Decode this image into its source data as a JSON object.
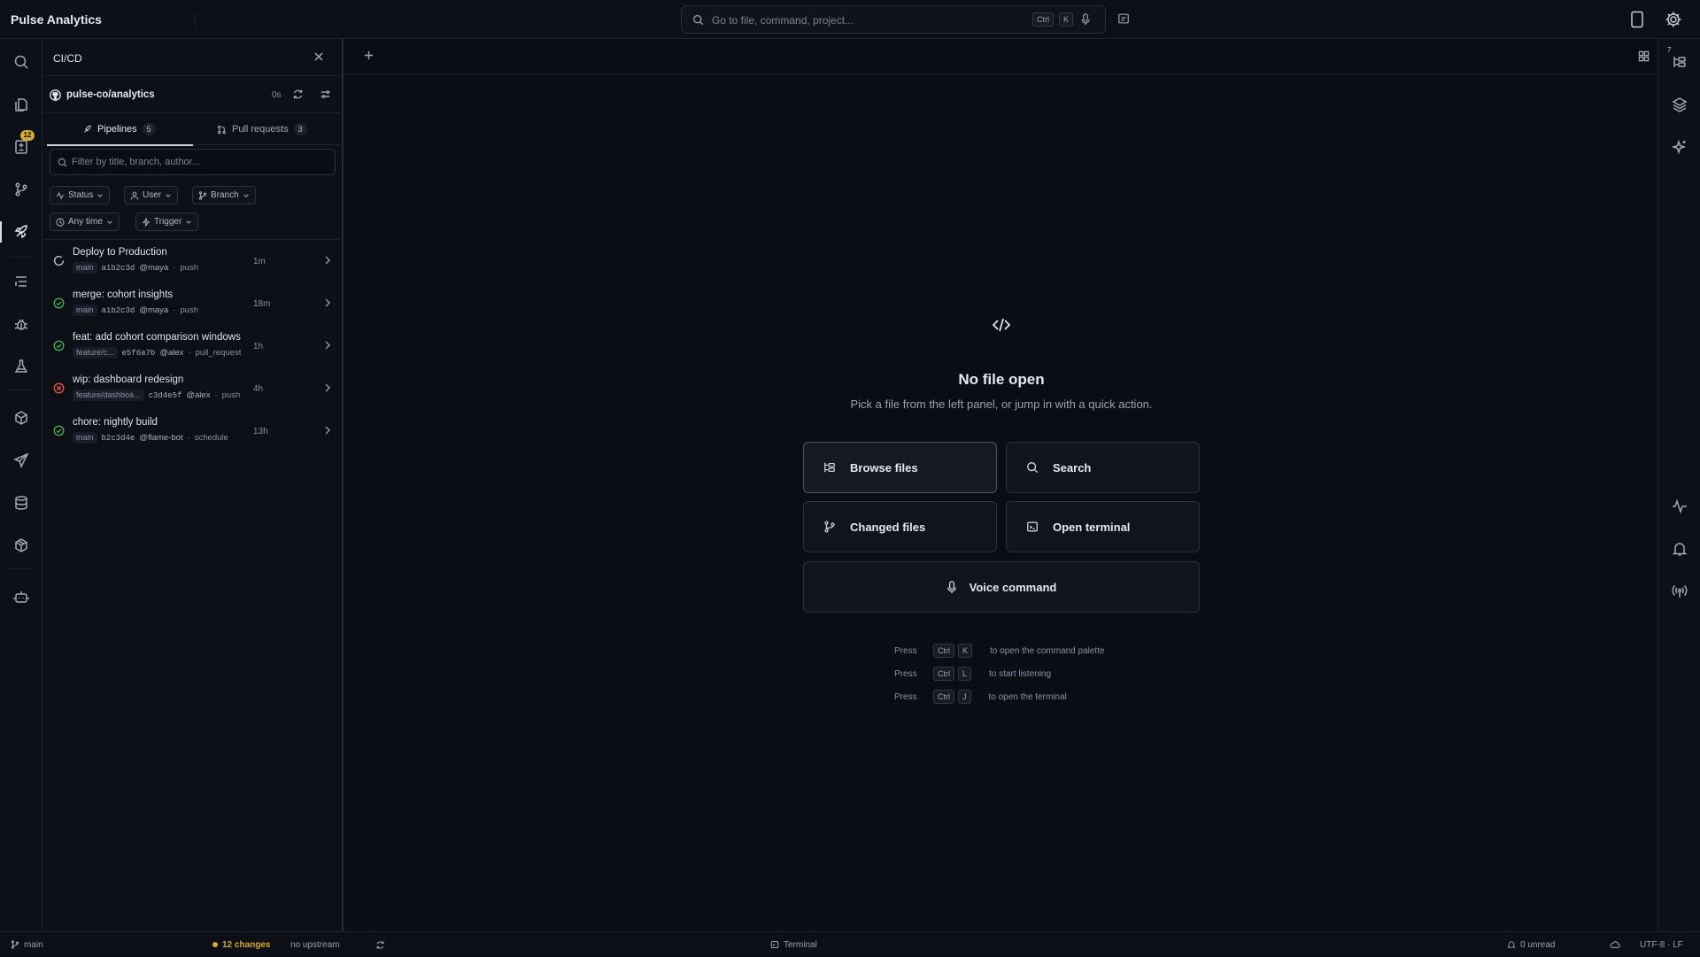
{
  "app": {
    "title": "Pulse Analytics"
  },
  "command_bar": {
    "placeholder": "Go to file, command, project...",
    "kbd": [
      "Ctrl",
      "K"
    ]
  },
  "activity_bar": {
    "items": [
      {
        "icon": "search-icon"
      },
      {
        "icon": "files-icon"
      },
      {
        "icon": "changes-icon",
        "badge": "12"
      },
      {
        "icon": "source-control-icon"
      },
      {
        "icon": "rocket-icon",
        "active": true
      },
      {
        "icon": "task-list-icon"
      },
      {
        "icon": "bug-icon"
      },
      {
        "icon": "flask-icon"
      },
      {
        "icon": "package-icon"
      },
      {
        "icon": "send-icon"
      },
      {
        "icon": "database-icon"
      },
      {
        "icon": "packages-icon"
      },
      {
        "icon": "bot-icon"
      }
    ]
  },
  "panel": {
    "title": "CI/CD",
    "repo": {
      "name": "pulse-co/analytics",
      "age": "0s"
    },
    "tabs": [
      {
        "label": "Pipelines",
        "count": "5",
        "active": true
      },
      {
        "label": "Pull requests",
        "count": "3"
      }
    ],
    "filter_placeholder": "Filter by title, branch, author...",
    "chips": [
      "Status",
      "User",
      "Branch",
      "Any time",
      "Trigger"
    ],
    "runs": [
      {
        "status": "running",
        "title": "Deploy to Production",
        "branch": "main",
        "sha": "a1b2c3d",
        "user": "@maya",
        "trigger": "push",
        "time": "1m"
      },
      {
        "status": "success",
        "title": "merge: cohort insights",
        "branch": "main",
        "sha": "a1b2c3d",
        "user": "@maya",
        "trigger": "push",
        "time": "18m"
      },
      {
        "status": "success",
        "title": "feat: add cohort comparison windows",
        "branch": "feature/c...",
        "sha": "e5f6a7b",
        "user": "@alex",
        "trigger": "pull_request",
        "time": "1h"
      },
      {
        "status": "failed",
        "title": "wip: dashboard redesign",
        "branch": "feature/dashboa...",
        "sha": "c3d4e5f",
        "user": "@alex",
        "trigger": "push",
        "time": "4h"
      },
      {
        "status": "success",
        "title": "chore: nightly build",
        "branch": "main",
        "sha": "b2c3d4e",
        "user": "@flame-bot",
        "trigger": "schedule",
        "time": "13h"
      }
    ]
  },
  "editor": {
    "empty_title": "No file open",
    "empty_subtitle": "Pick a file from the left panel, or jump in with a quick action.",
    "actions": {
      "browse": "Browse files",
      "search": "Search",
      "changed": "Changed files",
      "terminal": "Open terminal",
      "voice": "Voice command"
    },
    "hints": [
      {
        "press": "Press",
        "keys": [
          "Ctrl",
          "K"
        ],
        "desc": "to open the command palette"
      },
      {
        "press": "Press",
        "keys": [
          "Ctrl",
          "L"
        ],
        "desc": "to start listening"
      },
      {
        "press": "Press",
        "keys": [
          "Ctrl",
          "J"
        ],
        "desc": "to open the terminal"
      }
    ]
  },
  "right_bar": {
    "badge": "7"
  },
  "status_bar": {
    "branch": "main",
    "changes": "12 changes",
    "upstream": "no upstream",
    "terminal": "Terminal",
    "notifications": "0 unread",
    "encoding": "UTF-8 · LF"
  },
  "colors": {
    "background": "#0a0d14",
    "accent": "#d9a92c",
    "success": "#3fb950",
    "failure": "#f85149"
  }
}
